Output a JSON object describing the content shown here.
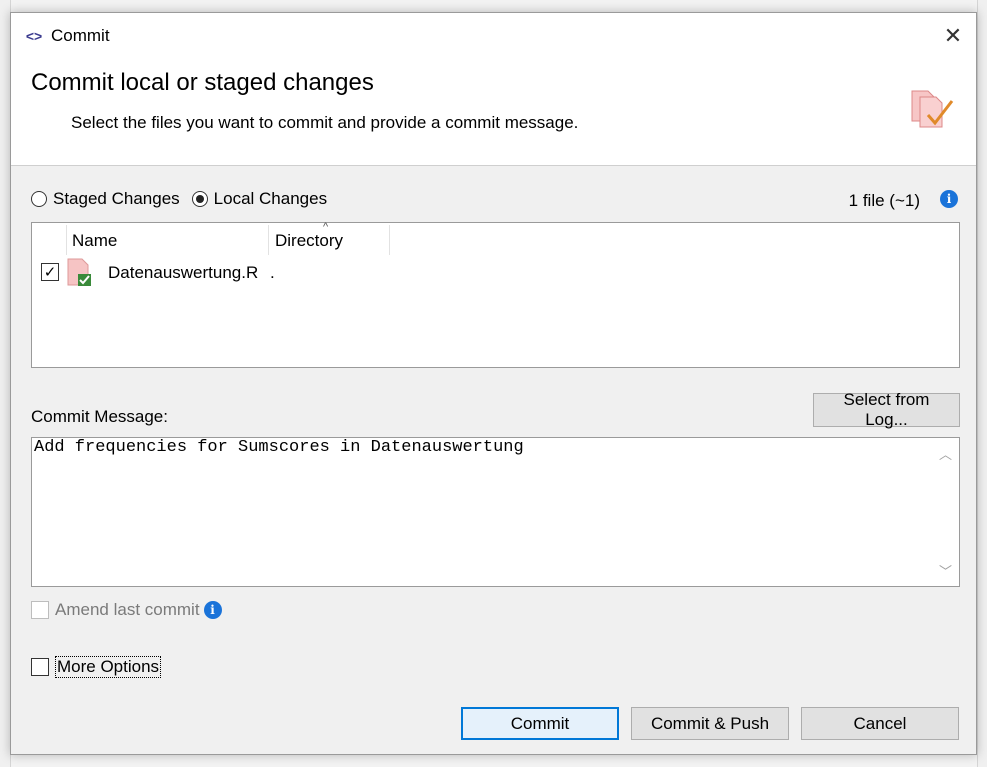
{
  "window": {
    "title": "Commit",
    "app_icon": "code-brackets-icon",
    "close_icon": "close-icon"
  },
  "header": {
    "title": "Commit local or staged changes",
    "subtitle": "Select the files you want to commit and provide a commit message.",
    "icon": "files-commit-check-icon"
  },
  "mode": {
    "options": [
      {
        "label": "Staged Changes",
        "selected": false
      },
      {
        "label": "Local Changes",
        "selected": true
      }
    ],
    "file_count": "1 file (~1)"
  },
  "file_list": {
    "columns": [
      "Name",
      "Directory"
    ],
    "rows": [
      {
        "checked": true,
        "name": "Datenauswertung.R",
        "directory": "."
      }
    ]
  },
  "commit": {
    "label": "Commit Message:",
    "select_from_log": "Select from Log...",
    "message": "Add frequencies for Sumscores in Datenauswertung"
  },
  "options": {
    "amend_label": "Amend last commit",
    "amend_checked": false,
    "amend_enabled": false,
    "more_label": "More Options",
    "more_checked": false
  },
  "buttons": {
    "commit": "Commit",
    "commit_push": "Commit & Push",
    "cancel": "Cancel"
  },
  "colors": {
    "accent": "#0078d7",
    "info": "#1a73d9",
    "file_icon": "#f2b8b8",
    "check": "#3a8a3a"
  }
}
